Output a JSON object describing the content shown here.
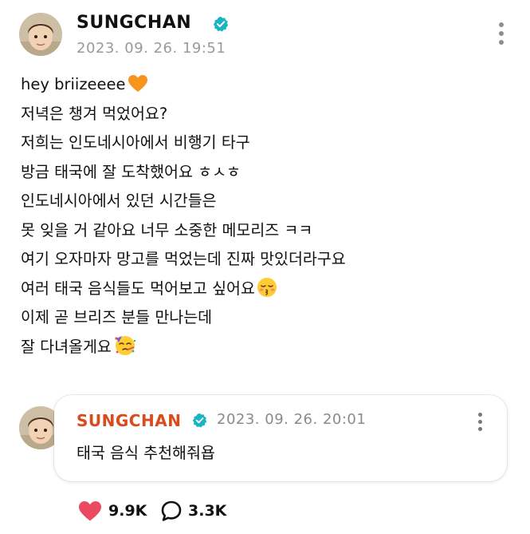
{
  "post": {
    "author": "SUNGCHAN",
    "timestamp": "2023. 09. 26. 19:51",
    "lines": [
      "hey briizeeee",
      "저녁은 챙겨 먹었어요?",
      "저희는 인도네시아에서 비행기 타구",
      "방금 태국에 잘 도착했어요 ㅎㅅㅎ",
      "인도네시아에서 있던 시간들은",
      "못 잊을 거 같아요 너무 소중한 메모리즈 ㅋㅋ",
      "여기 오자마자 망고를 먹었는데 진짜 맛있더라구요",
      "여러 태국 음식들도 먹어보고 싶어요",
      "이제 곧 브리즈 분들 만나는데",
      "잘 다녀올게요"
    ],
    "emojis": [
      "orange-heart",
      "kissing-face-with-closed-eyes",
      "partying-face"
    ]
  },
  "comment": {
    "author": "SUNGCHAN",
    "timestamp": "2023. 09. 26. 20:01",
    "text": "태국 음식 추천해줘욥"
  },
  "stats": {
    "likes": "9.9K",
    "comments": "3.3K"
  },
  "icons": {
    "verified": "verified-badge-icon",
    "more": "more-vertical-icon",
    "like": "heart-icon",
    "comment": "speech-bubble-icon"
  },
  "colors": {
    "verified_badge": "#19b5c4",
    "comment_author": "#d94a1c",
    "like_heart": "#e94a5f",
    "timestamp": "#9a9a9a"
  }
}
